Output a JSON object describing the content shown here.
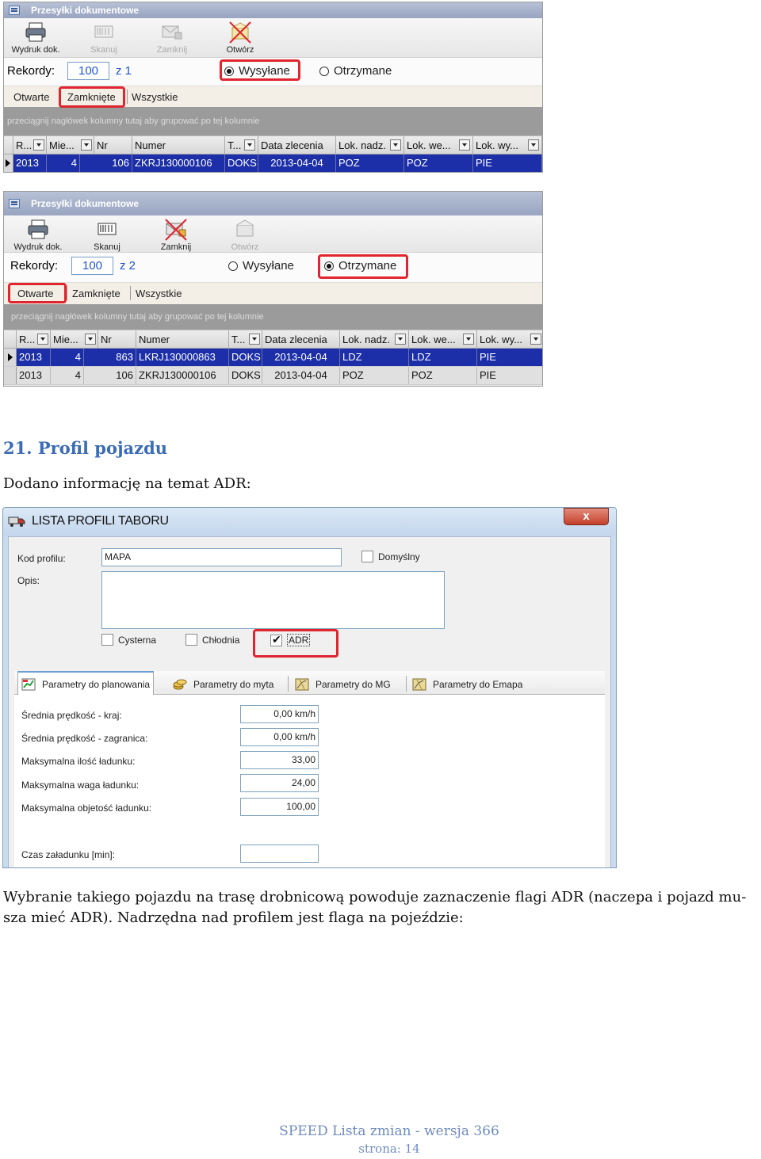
{
  "panel1": {
    "title": "Przesyłki dokumentowe",
    "toolbar": {
      "print": "Wydruk dok.",
      "scan": "Skanuj",
      "close": "Zamknij",
      "open": "Otwórz"
    },
    "records_label": "Rekordy:",
    "records_value": "100",
    "records_of": "z 1",
    "radio_sent": "Wysyłane",
    "radio_received": "Otrzymane",
    "tabs": [
      "Otwarte",
      "Zamknięte",
      "Wszystkie"
    ],
    "group_hint": "przeciągnij nagłówek kolumny tutaj aby grupować po tej kolumnie",
    "columns": [
      "R...",
      "Mie...",
      "Nr",
      "Numer",
      "T...",
      "Data zlecenia",
      "Lok. nadz.",
      "Lok. we...",
      "Lok. wy..."
    ],
    "rows": [
      [
        "2013",
        "4",
        "106",
        "ZKRJ130000106",
        "DOKS",
        "2013-04-04",
        "POZ",
        "POZ",
        "PIE"
      ]
    ]
  },
  "panel2": {
    "title": "Przesyłki dokumentowe",
    "toolbar": {
      "print": "Wydruk dok.",
      "scan": "Skanuj",
      "close": "Zamknij",
      "open": "Otwórz"
    },
    "records_label": "Rekordy:",
    "records_value": "100",
    "records_of": "z 2",
    "radio_sent": "Wysyłane",
    "radio_received": "Otrzymane",
    "tabs": [
      "Otwarte",
      "Zamknięte",
      "Wszystkie"
    ],
    "group_hint": "przeciągnij nagłówek kolumny tutaj aby grupować po tej kolumnie",
    "columns": [
      "R...",
      "Mie...",
      "Nr",
      "Numer",
      "T...",
      "Data zlecenia",
      "Lok. nadz.",
      "Lok. we...",
      "Lok. wy..."
    ],
    "rows": [
      [
        "2013",
        "4",
        "863",
        "LKRJ130000863",
        "DOKS",
        "2013-04-04",
        "LDZ",
        "LDZ",
        "PIE"
      ],
      [
        "2013",
        "4",
        "106",
        "ZKRJ130000106",
        "DOKS",
        "2013-04-04",
        "POZ",
        "POZ",
        "PIE"
      ]
    ]
  },
  "section": {
    "heading": "21. Profil pojazdu",
    "intro": "Dodano informację na temat ADR:",
    "after_line1": "Wybranie takiego pojazdu na trasę drobnicową powoduje zaznaczenie flagi ADR  (naczepa i pojazd mu-",
    "after_line2": "sza mieć ADR).  Nadrzędna nad profilem jest flaga na pojeździe:"
  },
  "dialog": {
    "title": "LISTA PROFILI TABORU",
    "close": "x",
    "code_label": "Kod profilu:",
    "code_value": "MAPA",
    "default_label": "Domyślny",
    "desc_label": "Opis:",
    "cb_tank": "Cysterna",
    "cb_cold": "Chłodnia",
    "cb_adr": "ADR",
    "tabs": [
      "Parametry do planowania",
      "Parametry do myta",
      "Parametry do MG",
      "Parametry do Emapa"
    ],
    "params": [
      {
        "label": "Średnia prędkość - kraj:",
        "value": "0,00 km/h"
      },
      {
        "label": "Średnia prędkość - zagranica:",
        "value": "0,00 km/h"
      },
      {
        "label": "Maksymalna ilość ładunku:",
        "value": "33,00"
      },
      {
        "label": "Maksymalna waga ładunku:",
        "value": "24,00"
      },
      {
        "label": "Maksymalna objetość ładunku:",
        "value": "100,00"
      }
    ],
    "load_time_label": "Czas załadunku [min]:",
    "load_time_value": ""
  },
  "footer": {
    "line1": "SPEED Lista zmian - wersja 366",
    "line2": "strona: 14"
  },
  "colors": {
    "highlight": "#e0252e",
    "heading": "#3b6cb5",
    "selected_row": "#1c2fa8",
    "footer": "#6f8bbf"
  }
}
